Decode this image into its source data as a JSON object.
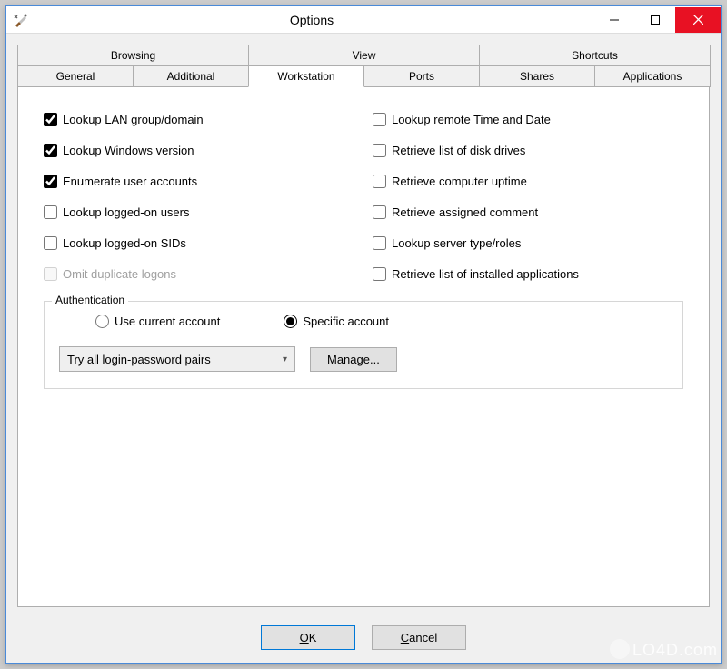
{
  "window": {
    "title": "Options"
  },
  "tabs": {
    "top": [
      {
        "label": "Browsing"
      },
      {
        "label": "View"
      },
      {
        "label": "Shortcuts"
      }
    ],
    "bottom": [
      {
        "label": "General"
      },
      {
        "label": "Additional"
      },
      {
        "label": "Workstation",
        "active": true
      },
      {
        "label": "Ports"
      },
      {
        "label": "Shares"
      },
      {
        "label": "Applications"
      }
    ]
  },
  "options": {
    "left": [
      {
        "label": "Lookup LAN group/domain",
        "checked": true
      },
      {
        "label": "Lookup Windows version",
        "checked": true
      },
      {
        "label": "Enumerate user accounts",
        "checked": true
      },
      {
        "label": "Lookup logged-on users",
        "checked": false
      },
      {
        "label": "Lookup logged-on SIDs",
        "checked": false
      },
      {
        "label": "Omit duplicate logons",
        "checked": false,
        "disabled": true
      }
    ],
    "right": [
      {
        "label": "Lookup remote Time and Date",
        "checked": false
      },
      {
        "label": "Retrieve list of disk drives",
        "checked": false
      },
      {
        "label": "Retrieve computer uptime",
        "checked": false
      },
      {
        "label": "Retrieve assigned comment",
        "checked": false
      },
      {
        "label": "Lookup server type/roles",
        "checked": false
      },
      {
        "label": "Retrieve list of installed applications",
        "checked": false
      }
    ]
  },
  "auth": {
    "group_label": "Authentication",
    "radio": {
      "current": "Use current account",
      "specific": "Specific account",
      "selected": "specific"
    },
    "combo_value": "Try all login-password pairs",
    "manage_label": "Manage..."
  },
  "footer": {
    "ok": "OK",
    "cancel": "Cancel"
  },
  "watermark": "LO4D.com"
}
